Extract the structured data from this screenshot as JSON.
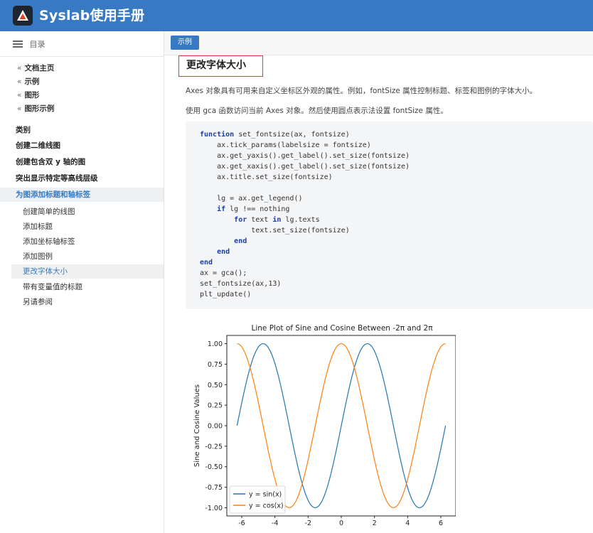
{
  "app": {
    "title": "Syslab使用手册"
  },
  "sidebar": {
    "toc_label": "目录",
    "breadcrumbs": [
      "文档主页",
      "示例",
      "图形",
      "图形示例"
    ],
    "category_label": "类别",
    "top_items": [
      "创建二维线图",
      "创建包含双 y 轴的图",
      "突出显示特定等高线层级"
    ],
    "active_group": "为图添加标题和轴标签",
    "sub_items": [
      "创建简单的线图",
      "添加标题",
      "添加坐标轴标签",
      "添加图例",
      "更改字体大小",
      "带有变量值的标题",
      "另请参阅"
    ],
    "current_sub": "更改字体大小"
  },
  "main": {
    "tab_label": "示例",
    "section_title": "更改字体大小",
    "para1": "Axes 对象具有可用来自定义坐标区外观的属性。例如，fontSize 属性控制标题、标签和图例的字体大小。",
    "para2": "使用 gca 函数访问当前 Axes 对象。然后使用圆点表示法设置 fontSize 属性。",
    "code_lines": [
      "function set_fontsize(ax, fontsize)",
      "    ax.tick_params(labelsize = fontsize)",
      "    ax.get_yaxis().get_label().set_size(fontsize)",
      "    ax.get_xaxis().get_label().set_size(fontsize)",
      "    ax.title.set_size(fontsize)",
      "",
      "    lg = ax.get_legend()",
      "    if lg !== nothing",
      "        for text in lg.texts",
      "            text.set_size(fontsize)",
      "        end",
      "    end",
      "end",
      "ax = gca();",
      "set_fontsize(ax,13)",
      "plt_update()"
    ]
  },
  "chart_data": {
    "type": "line",
    "title": "Line Plot of Sine and Cosine Between -2π and 2π",
    "xlabel": "",
    "ylabel": "Sine and Cosine Values",
    "xlim": [
      -6.9,
      6.9
    ],
    "ylim": [
      -1.1,
      1.1
    ],
    "x_ticks": [
      "-6",
      "-4",
      "-2",
      "0",
      "2",
      "4",
      "6"
    ],
    "y_ticks": [
      "1.00",
      "0.75",
      "0.50",
      "0.25",
      "0.00",
      "-0.25",
      "-0.50",
      "-0.75",
      "-1.00"
    ],
    "x_range": [
      -6.2832,
      6.2832
    ],
    "series": [
      {
        "name": "y = sin(x)",
        "function": "sin",
        "color": "#1f77b4"
      },
      {
        "name": "y = cos(x)",
        "function": "cos",
        "color": "#ff7f0e"
      }
    ],
    "legend": "bottom-left",
    "grid": false
  }
}
